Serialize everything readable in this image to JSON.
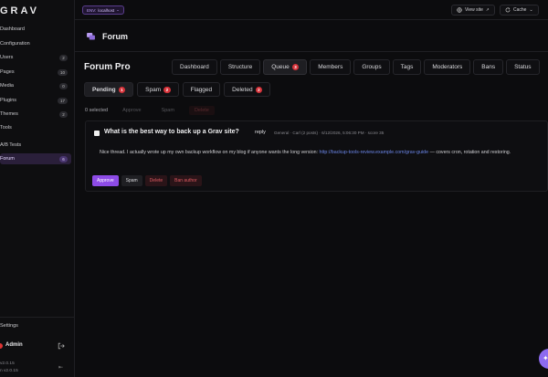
{
  "app": {
    "logo": "GRAV"
  },
  "sidebar": {
    "items": [
      {
        "label": "Dashboard",
        "badge": ""
      },
      {
        "label": "Configuration",
        "badge": ""
      },
      {
        "label": "Users",
        "badge": "2"
      },
      {
        "label": "Pages",
        "badge": "10"
      },
      {
        "label": "Media",
        "badge": "0"
      },
      {
        "label": "Plugins",
        "badge": "17"
      },
      {
        "label": "Themes",
        "badge": "2"
      },
      {
        "label": "Tools",
        "badge": ""
      },
      {
        "label": "A/B Tests",
        "badge": ""
      },
      {
        "label": "Forum",
        "badge": "6"
      }
    ],
    "settings": "Settings",
    "user": "Admin",
    "version1": "v2.0.15",
    "version2": "n v2.0.15"
  },
  "topbar": {
    "env_label": "ENV:",
    "env_value": "localhost",
    "view_site": "View site",
    "cache": "Cache"
  },
  "page": {
    "title": "Forum"
  },
  "plugin": {
    "title": "Forum Pro",
    "tabs": [
      {
        "label": "Dashboard",
        "badge": ""
      },
      {
        "label": "Structure",
        "badge": ""
      },
      {
        "label": "Queue",
        "badge": "3"
      },
      {
        "label": "Members",
        "badge": ""
      },
      {
        "label": "Groups",
        "badge": ""
      },
      {
        "label": "Tags",
        "badge": ""
      },
      {
        "label": "Moderators",
        "badge": ""
      },
      {
        "label": "Bans",
        "badge": ""
      },
      {
        "label": "Status",
        "badge": ""
      }
    ],
    "subtabs": [
      {
        "label": "Pending",
        "badge": "1"
      },
      {
        "label": "Spam",
        "badge": "2"
      },
      {
        "label": "Flagged",
        "badge": ""
      },
      {
        "label": "Deleted",
        "badge": "2"
      }
    ]
  },
  "bulk": {
    "selected": "0 selected",
    "approve": "Approve",
    "spam": "Spam",
    "delete": "Delete"
  },
  "post": {
    "title": "What is the best way to back up a Grav site?",
    "type": "reply",
    "meta": "General · Carl (2 posts) · 6/12/2026, 5:06:30 PM · score 35",
    "body_pre": "Nice thread. I actually wrote up my own backup workflow on my blog if anyone wants the long version: ",
    "body_link": "http://backup-tools-review.example.com/grav-guide",
    "body_post": " — covers cron, rotation and restoring.",
    "actions": {
      "approve": "Approve",
      "spam": "Spam",
      "delete": "Delete",
      "ban": "Ban author"
    }
  },
  "colors": {
    "accent": "#8d4be6",
    "danger": "#d6333a",
    "link": "#6b86e8"
  }
}
